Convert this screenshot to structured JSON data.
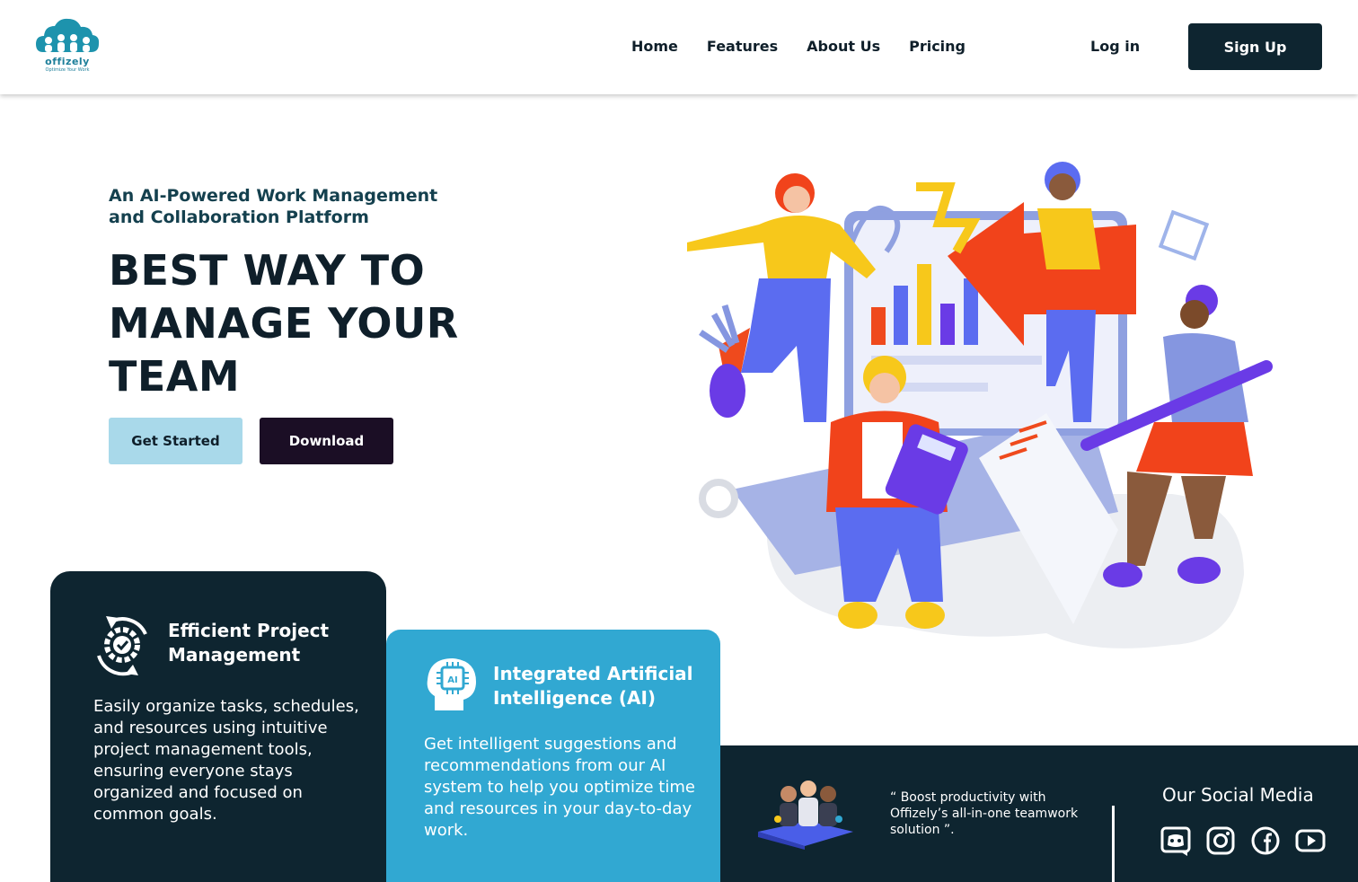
{
  "brand": {
    "name": "offizely",
    "tagline": "Optimize Your Work",
    "color": "#1d7f9a"
  },
  "nav": {
    "items": [
      "Home",
      "Features",
      "About Us",
      "Pricing"
    ]
  },
  "auth": {
    "login": "Log in",
    "signup": "Sign Up"
  },
  "hero": {
    "tagline": "An AI-Powered Work Management and Collaboration Platform",
    "headline": "BEST WAY TO MANAGE YOUR TEAM",
    "primary_cta": "Get Started",
    "secondary_cta": "Download",
    "illustration_icon": "team-illustration"
  },
  "features": [
    {
      "icon": "gear-cycle-icon",
      "title": "Efficient Project Management",
      "text": "Easily organize tasks, schedules, and resources using intuitive project management tools, ensuring everyone stays organized and focused on common goals."
    },
    {
      "icon": "ai-head-icon",
      "title": "Integrated Artificial Intelligence (AI)",
      "text": "Get intelligent suggestions and recommendations from our AI system to help you optimize time and resources in your day-to-day work."
    }
  ],
  "footer_band": {
    "quote": "“ Boost productivity with Offizely’s all-in-one teamwork solution ”.",
    "social_title": "Our Social Media",
    "social": [
      "discord-icon",
      "instagram-icon",
      "facebook-icon",
      "youtube-icon"
    ]
  },
  "colors": {
    "dark": "#0e2530",
    "accent_blue": "#31a8d2",
    "light_blue": "#a9d9ea",
    "download_bg": "#1b0e25"
  }
}
